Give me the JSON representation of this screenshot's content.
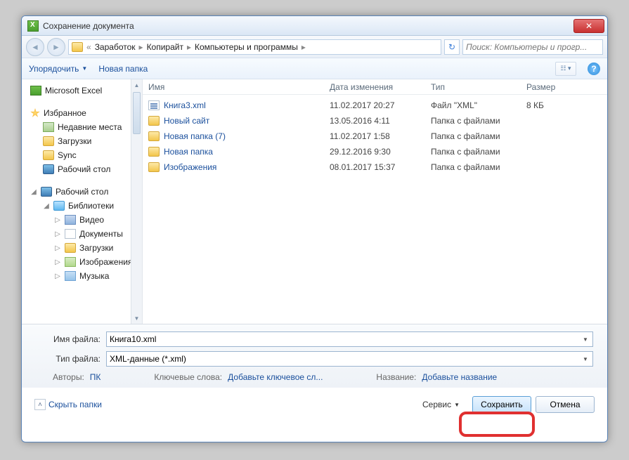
{
  "window": {
    "title": "Сохранение документа"
  },
  "breadcrumb": {
    "prefix": "«",
    "items": [
      "Заработок",
      "Копирайт",
      "Компьютеры и программы"
    ]
  },
  "search": {
    "placeholder": "Поиск: Компьютеры и прогр..."
  },
  "toolbar": {
    "organize": "Упорядочить",
    "newfolder": "Новая папка"
  },
  "sidebar": {
    "app": "Microsoft Excel",
    "favorites": "Избранное",
    "recent": "Недавние места",
    "downloads": "Загрузки",
    "sync": "Sync",
    "desktopFav": "Рабочий стол",
    "desktop": "Рабочий стол",
    "libraries": "Библиотеки",
    "video": "Видео",
    "documents": "Документы",
    "downloads2": "Загрузки",
    "pictures": "Изображения",
    "music": "Музыка"
  },
  "columns": {
    "name": "Имя",
    "date": "Дата изменения",
    "type": "Тип",
    "size": "Размер"
  },
  "files": [
    {
      "icon": "xml",
      "name": "Книга3.xml",
      "date": "11.02.2017 20:27",
      "type": "Файл \"XML\"",
      "size": "8 КБ"
    },
    {
      "icon": "folder",
      "name": "Новый сайт",
      "date": "13.05.2016 4:11",
      "type": "Папка с файлами",
      "size": ""
    },
    {
      "icon": "folder",
      "name": "Новая папка (7)",
      "date": "11.02.2017 1:58",
      "type": "Папка с файлами",
      "size": ""
    },
    {
      "icon": "folder",
      "name": "Новая папка",
      "date": "29.12.2016 9:30",
      "type": "Папка с файлами",
      "size": ""
    },
    {
      "icon": "folder",
      "name": "Изображения",
      "date": "08.01.2017 15:37",
      "type": "Папка с файлами",
      "size": ""
    }
  ],
  "filename": {
    "label": "Имя файла:",
    "value": "Книга10.xml"
  },
  "filetype": {
    "label": "Тип файла:",
    "value": "XML-данные (*.xml)"
  },
  "meta": {
    "authorsLabel": "Авторы:",
    "authors": "ПК",
    "tagsLabel": "Ключевые слова:",
    "tags": "Добавьте ключевое сл...",
    "titleLabel": "Название:",
    "title": "Добавьте название"
  },
  "footer": {
    "hide": "Скрыть папки",
    "service": "Сервис",
    "save": "Сохранить",
    "cancel": "Отмена"
  }
}
